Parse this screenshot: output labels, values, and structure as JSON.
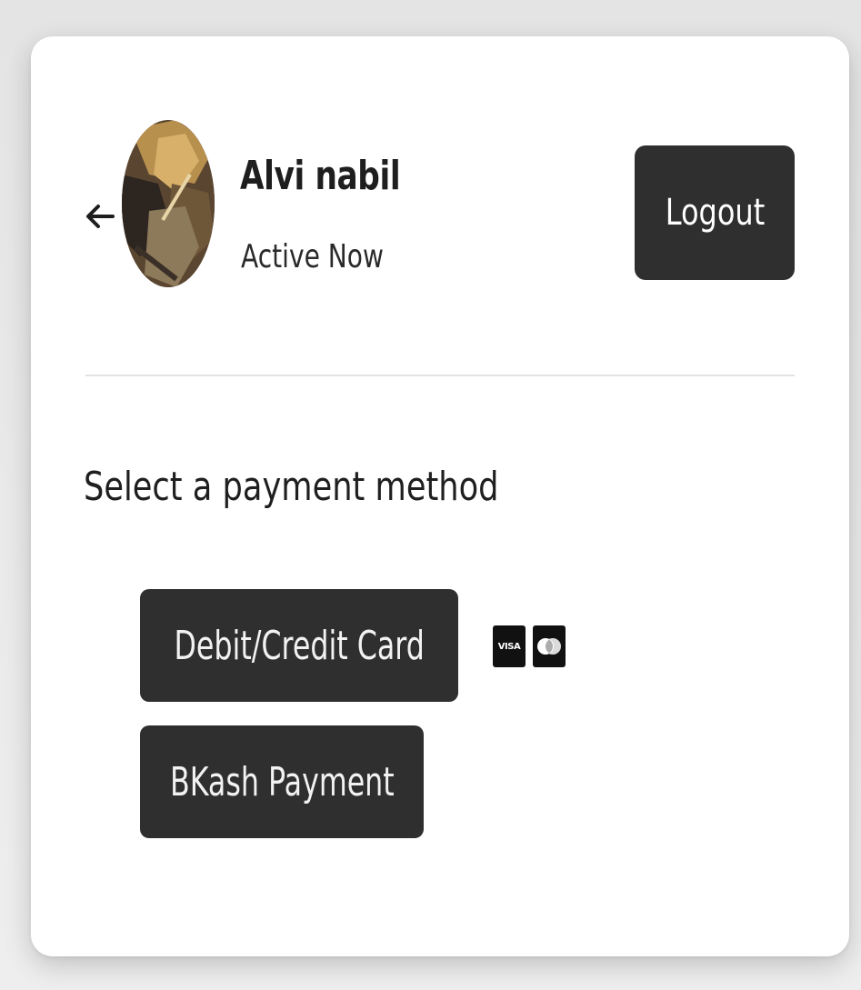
{
  "header": {
    "user_name": "Alvi nabil",
    "user_status": "Active Now",
    "logout_label": "Logout",
    "back_icon": "arrow-left-icon",
    "avatar": "user-avatar-photo"
  },
  "payment": {
    "title": "Select a payment method",
    "methods": [
      {
        "label": "Debit/Credit Card",
        "logos": [
          "visa-logo",
          "mastercard-logo"
        ]
      },
      {
        "label": "BKash Payment"
      }
    ],
    "visa_text": "VISA"
  },
  "colors": {
    "button_bg": "#2f2f2f",
    "button_text": "#ffffff",
    "card_bg": "#ffffff",
    "page_bg": "#e6e6e6",
    "divider": "#e2e2e2"
  }
}
